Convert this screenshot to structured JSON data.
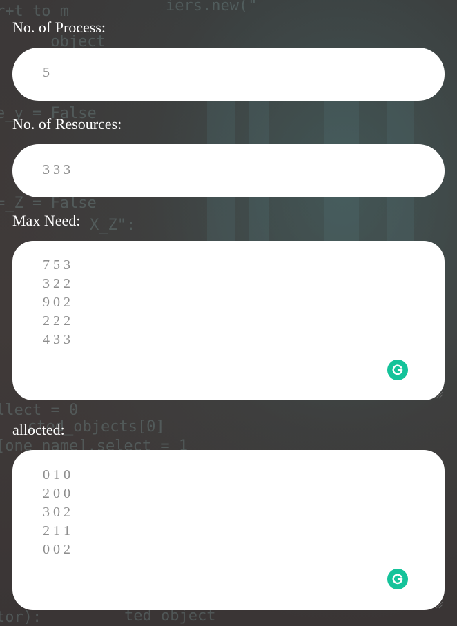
{
  "fields": [
    {
      "label": "No. of Process:",
      "value": "5"
    },
    {
      "label": "No. of Resources:",
      "value": "3 3 3"
    },
    {
      "label": "Max Need:",
      "value": "7 5 3\n3 2 2\n9 0 2\n2 2 2\n4 3 3"
    },
    {
      "label": "allocted:",
      "value": "0 1 0\n2 0 0\n3 0 2\n2 1 1\n0 0 2"
    }
  ],
  "colors": {
    "accent": "#15c39a",
    "field_bg": "#ffffff",
    "value_text": "#8e8e8e"
  }
}
